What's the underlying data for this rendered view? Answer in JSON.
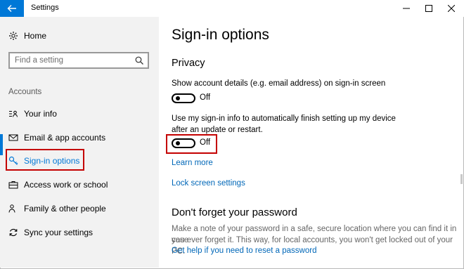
{
  "window": {
    "title": "Settings"
  },
  "sidebar": {
    "home_label": "Home",
    "search_placeholder": "Find a setting",
    "section_label": "Accounts",
    "items": [
      {
        "label": "Your info",
        "icon": "person-card-icon"
      },
      {
        "label": "Email & app accounts",
        "icon": "envelope-icon"
      },
      {
        "label": "Sign-in options",
        "icon": "key-icon",
        "selected": true
      },
      {
        "label": "Access work or school",
        "icon": "briefcase-icon"
      },
      {
        "label": "Family & other people",
        "icon": "people-icon"
      },
      {
        "label": "Sync your settings",
        "icon": "sync-icon"
      }
    ]
  },
  "main": {
    "title": "Sign-in options",
    "privacy": {
      "heading": "Privacy",
      "setting1_text": "Show account details (e.g. email address) on sign-in screen",
      "setting1_state": "Off",
      "setting2_text_line1": "Use my sign-in info to automatically finish setting up my device",
      "setting2_text_line2": "after an update or restart.",
      "setting2_state": "Off",
      "learn_more": "Learn more",
      "lock_screen_link": "Lock screen settings"
    },
    "password": {
      "heading": "Don't forget your password",
      "text_line1": "Make a note of your password in a safe, secure location where you can find it in case",
      "text_line2": "you ever forget it. This way, for local accounts, you won't get locked out of your PC.",
      "help_link": "Get help if you need to reset a password"
    }
  },
  "colors": {
    "accent": "#0078d7",
    "highlight": "#c40000",
    "link": "#0067b8",
    "sidebar_bg": "#f2f2f2"
  }
}
